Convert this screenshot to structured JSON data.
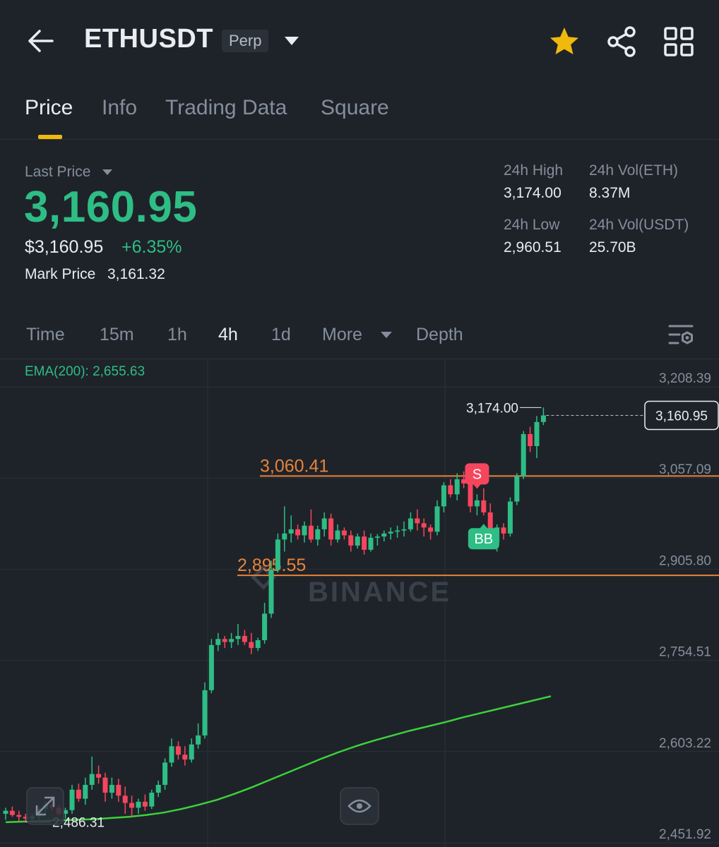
{
  "header": {
    "symbol": "ETHUSDT",
    "contract_type": "Perp",
    "icons": [
      "arrow-left-icon",
      "caret-down-icon",
      "star-icon",
      "share-icon",
      "grid-icon"
    ],
    "favorite_color": "#f0b90b"
  },
  "tabs": [
    {
      "label": "Price",
      "active": true
    },
    {
      "label": "Info",
      "active": false
    },
    {
      "label": "Trading Data",
      "active": false
    },
    {
      "label": "Square",
      "active": false
    }
  ],
  "price": {
    "last_label": "Last Price",
    "last_price": "3,160.95",
    "usd_price": "$3,160.95",
    "change": "+6.35%",
    "mark_label": "Mark Price",
    "mark_price": "3,161.32"
  },
  "stats": {
    "high_label": "24h High",
    "high_value": "3,174.00",
    "vol_eth_label": "24h Vol(ETH)",
    "vol_eth_value": "8.37M",
    "low_label": "24h Low",
    "low_value": "2,960.51",
    "vol_usdt_label": "24h Vol(USDT)",
    "vol_usdt_value": "25.70B"
  },
  "intervals": {
    "items": [
      {
        "label": "Time",
        "active": false
      },
      {
        "label": "15m",
        "active": false
      },
      {
        "label": "1h",
        "active": false
      },
      {
        "label": "4h",
        "active": true
      },
      {
        "label": "1d",
        "active": false
      },
      {
        "label": "More",
        "active": false
      },
      {
        "label": "Depth",
        "active": false
      }
    ]
  },
  "colors": {
    "up": "#2ebd85",
    "down": "#f6465d",
    "level_line": "#e8833a",
    "ema": "#3cd13c",
    "background": "#1e2329"
  },
  "chart_data": {
    "type": "candlestick",
    "watermark": "BINANCE",
    "indicator": {
      "label": "EMA(200): 2,655.63",
      "name": "EMA(200)",
      "value": 2655.63
    },
    "y_ticks": [
      "3,208.39",
      "3,057.09",
      "2,905.80",
      "2,754.51",
      "2,603.22",
      "2,451.92"
    ],
    "ylim": [
      2451.92,
      3208.39
    ],
    "current_price": {
      "label": "3,160.95",
      "value": 3160.95
    },
    "high_marker": {
      "label": "3,174.00",
      "value": 3174.0
    },
    "low_marker": {
      "label": "2,486.31",
      "value": 2486.31
    },
    "levels": [
      {
        "label": "3,060.41",
        "value": 3060.41
      },
      {
        "label": "2,895.55",
        "value": 2895.55
      }
    ],
    "signals": [
      {
        "label": "S",
        "type": "sell",
        "candle_index": 71
      },
      {
        "label": "BB",
        "type": "buy",
        "candle_index": 72
      }
    ],
    "candles": [
      [
        2500,
        2510,
        2490,
        2505
      ],
      [
        2505,
        2512,
        2495,
        2498
      ],
      [
        2498,
        2505,
        2488,
        2495
      ],
      [
        2495,
        2500,
        2486.31,
        2492
      ],
      [
        2492,
        2500,
        2485,
        2496
      ],
      [
        2496,
        2512,
        2490,
        2508
      ],
      [
        2508,
        2520,
        2500,
        2515
      ],
      [
        2515,
        2525,
        2505,
        2510
      ],
      [
        2510,
        2515,
        2495,
        2500
      ],
      [
        2500,
        2510,
        2492,
        2506
      ],
      [
        2506,
        2548,
        2500,
        2540
      ],
      [
        2540,
        2550,
        2520,
        2525
      ],
      [
        2525,
        2560,
        2515,
        2548
      ],
      [
        2548,
        2595,
        2540,
        2566
      ],
      [
        2566,
        2580,
        2550,
        2560
      ],
      [
        2560,
        2568,
        2520,
        2535
      ],
      [
        2535,
        2560,
        2525,
        2548
      ],
      [
        2548,
        2558,
        2520,
        2530
      ],
      [
        2530,
        2545,
        2500,
        2518
      ],
      [
        2518,
        2530,
        2495,
        2510
      ],
      [
        2510,
        2525,
        2500,
        2520
      ],
      [
        2520,
        2532,
        2505,
        2512
      ],
      [
        2512,
        2540,
        2508,
        2535
      ],
      [
        2535,
        2555,
        2528,
        2548
      ],
      [
        2548,
        2592,
        2540,
        2585
      ],
      [
        2585,
        2625,
        2578,
        2612
      ],
      [
        2612,
        2620,
        2590,
        2598
      ],
      [
        2598,
        2612,
        2580,
        2590
      ],
      [
        2590,
        2625,
        2585,
        2615
      ],
      [
        2615,
        2650,
        2608,
        2630
      ],
      [
        2630,
        2718,
        2625,
        2705
      ],
      [
        2705,
        2790,
        2700,
        2780
      ],
      [
        2780,
        2800,
        2770,
        2790
      ],
      [
        2790,
        2795,
        2775,
        2785
      ],
      [
        2785,
        2800,
        2775,
        2790
      ],
      [
        2790,
        2815,
        2780,
        2795
      ],
      [
        2795,
        2805,
        2780,
        2785
      ],
      [
        2785,
        2800,
        2765,
        2775
      ],
      [
        2775,
        2792,
        2770,
        2788
      ],
      [
        2788,
        2850,
        2782,
        2832
      ],
      [
        2832,
        2920,
        2825,
        2905
      ],
      [
        2905,
        2965,
        2900,
        2955
      ],
      [
        2955,
        3010,
        2935,
        2965
      ],
      [
        2965,
        2995,
        2950,
        2972
      ],
      [
        2972,
        2980,
        2955,
        2962
      ],
      [
        2962,
        2985,
        2950,
        2978
      ],
      [
        2978,
        3005,
        2950,
        2955
      ],
      [
        2955,
        2978,
        2945,
        2972
      ],
      [
        2972,
        3000,
        2960,
        2990
      ],
      [
        2990,
        2998,
        2945,
        2955
      ],
      [
        2955,
        2980,
        2950,
        2970
      ],
      [
        2970,
        2975,
        2955,
        2962
      ],
      [
        2962,
        2970,
        2935,
        2945
      ],
      [
        2945,
        2965,
        2940,
        2960
      ],
      [
        2960,
        2970,
        2930,
        2938
      ],
      [
        2938,
        2965,
        2935,
        2958
      ],
      [
        2958,
        2964,
        2945,
        2960
      ],
      [
        2960,
        2970,
        2952,
        2965
      ],
      [
        2965,
        2975,
        2955,
        2968
      ],
      [
        2968,
        2978,
        2958,
        2970
      ],
      [
        2970,
        2985,
        2960,
        2972
      ],
      [
        2972,
        3000,
        2968,
        2990
      ],
      [
        2990,
        3005,
        2970,
        2982
      ],
      [
        2982,
        2990,
        2960,
        2975
      ],
      [
        2975,
        2980,
        2955,
        2968
      ],
      [
        2968,
        3020,
        2962,
        3010
      ],
      [
        3010,
        3050,
        3000,
        3045
      ],
      [
        3045,
        3055,
        3025,
        3030
      ],
      [
        3030,
        3065,
        3020,
        3055
      ],
      [
        3055,
        3068,
        3040,
        3048
      ],
      [
        3048,
        3055,
        3000,
        3010
      ],
      [
        3010,
        3030,
        2995,
        3020
      ],
      [
        3020,
        3040,
        2995,
        3000
      ],
      [
        3000,
        3015,
        2940,
        2950
      ],
      [
        2950,
        2980,
        2935,
        2975
      ],
      [
        2975,
        2982,
        2955,
        2965
      ],
      [
        2965,
        3025,
        2960,
        3018
      ],
      [
        3018,
        3065,
        3012,
        3060
      ],
      [
        3060,
        3135,
        3055,
        3130
      ],
      [
        3130,
        3142,
        3100,
        3110
      ],
      [
        3110,
        3160,
        3090,
        3150
      ],
      [
        3150,
        3174,
        3145,
        3160.95
      ]
    ],
    "ema": [
      2486,
      2487,
      2488,
      2489,
      2490,
      2491,
      2493,
      2495,
      2498,
      2502,
      2508,
      2515,
      2523,
      2533,
      2544,
      2556,
      2568,
      2580,
      2592,
      2603,
      2613,
      2622,
      2630,
      2638,
      2645,
      2652,
      2660,
      2667,
      2674,
      2681,
      2688,
      2695
    ]
  }
}
